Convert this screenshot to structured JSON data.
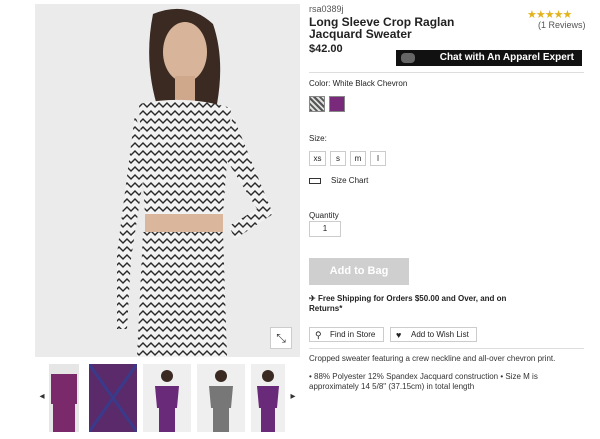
{
  "product": {
    "sku": "rsa0389j",
    "title": "Long Sleeve Crop Raglan Jacquard Sweater",
    "price": "$42.00",
    "rating_stars": "★★★★★",
    "reviews": "(1 Reviews)"
  },
  "chat": {
    "label": "Chat with An Apparel Expert"
  },
  "color": {
    "label": "Color:",
    "selected": "White Black Chevron",
    "swatch_colors": [
      "#8a8a8a",
      "#7a2a7a"
    ]
  },
  "size": {
    "label": "Size:",
    "options": [
      "xs",
      "s",
      "m",
      "l"
    ],
    "chart_label": "Size Chart"
  },
  "quantity": {
    "label": "Quantity",
    "value": "1"
  },
  "cart": {
    "add_label": "Add to Bag"
  },
  "shipping": {
    "text": "Free Shipping for Orders $50.00 and Over, and on Returns*"
  },
  "actions": {
    "find_store": "Find in Store",
    "wishlist": "Add to Wish List"
  },
  "description": {
    "summary": "Cropped sweater featuring a crew neckline and all-over chevron print.",
    "details": "• 88% Polyester 12% Spandex Jacquard construction • Size M is approximately 14 5/8\" (37.15cm) in total length"
  },
  "gallery": {
    "expand_icon": "⤡",
    "prev_icon": "◂",
    "next_icon": "▸"
  }
}
